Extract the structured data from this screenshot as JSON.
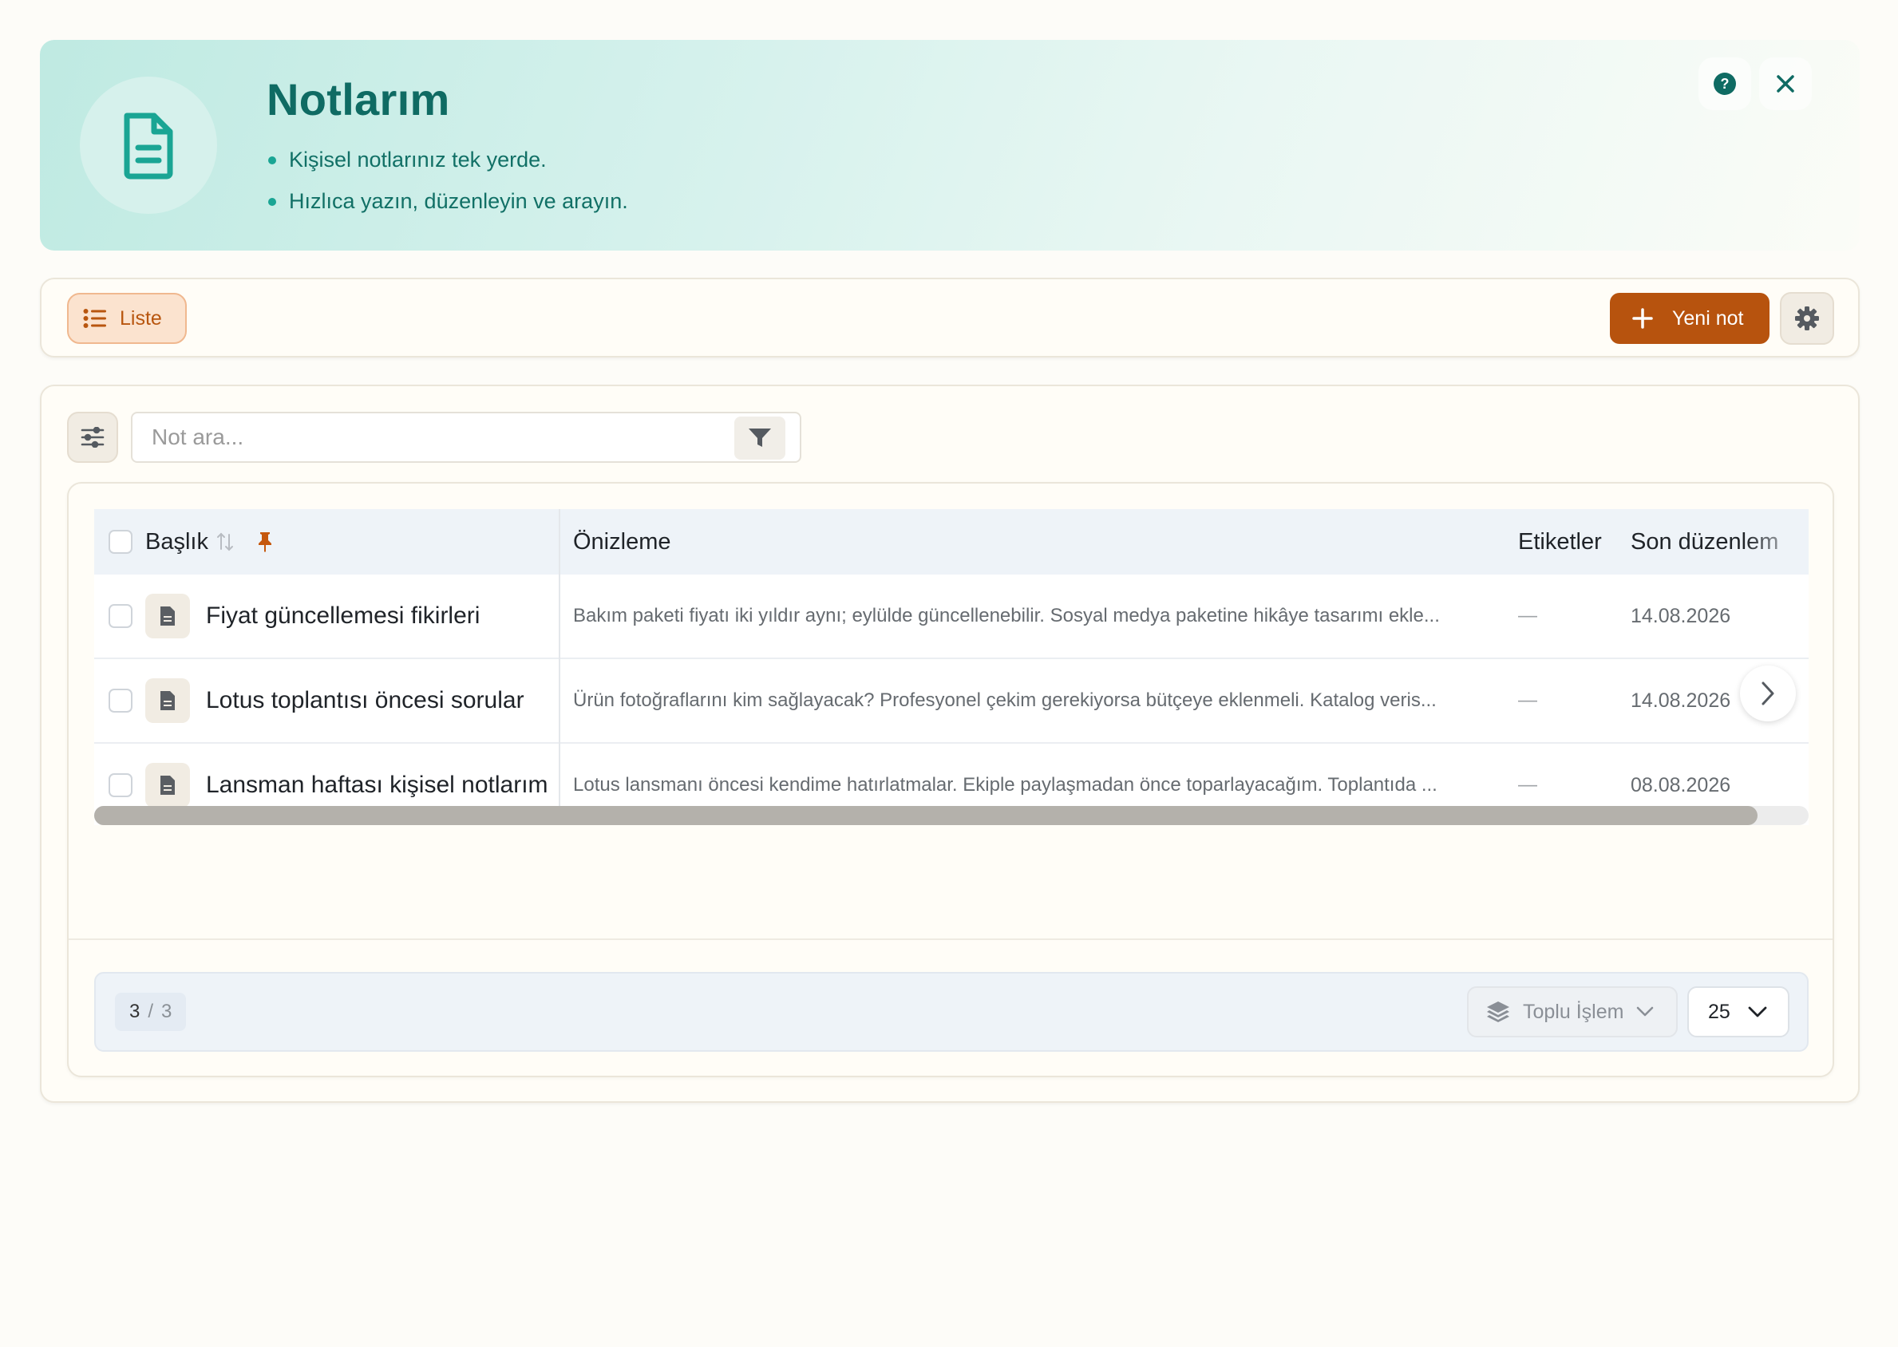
{
  "hero": {
    "title": "Notlarım",
    "bullets": [
      "Kişisel notlarınız tek yerde.",
      "Hızlıca yazın, düzenleyin ve arayın."
    ],
    "accent": "#0f6b63"
  },
  "toolbar": {
    "view_label": "Liste",
    "new_label": "Yeni not",
    "accent": "#b7530e"
  },
  "search": {
    "placeholder": "Not ara...",
    "value": ""
  },
  "table": {
    "columns": {
      "title": "Başlık",
      "preview": "Önizleme",
      "tags": "Etiketler",
      "modified": "Son düzenlem"
    },
    "rows": [
      {
        "title": "Fiyat güncellemesi fikirleri",
        "preview": "Bakım paketi fiyatı iki yıldır aynı; eylülde güncellenebilir. Sosyal medya paketine hikâye tasarımı ekle...",
        "tags": "—",
        "modified": "14.08.2026"
      },
      {
        "title": "Lotus toplantısı öncesi sorular",
        "preview": "Ürün fotoğraflarını kim sağlayacak? Profesyonel çekim gerekiyorsa bütçeye eklenmeli. Katalog veris...",
        "tags": "—",
        "modified": "14.08.2026"
      },
      {
        "title": "Lansman haftası kişisel notlarım",
        "preview": "Lotus lansmanı öncesi kendime hatırlatmalar. Ekiple paylaşmadan önce toparlayacağım. Toplantıda ...",
        "tags": "—",
        "modified": "08.08.2026"
      }
    ]
  },
  "footer": {
    "count_shown": "3",
    "count_sep": "/",
    "count_total": "3",
    "bulk_label": "Toplu İşlem",
    "per_page": "25"
  }
}
